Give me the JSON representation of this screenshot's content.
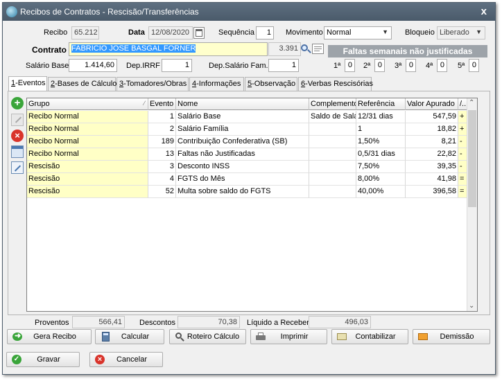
{
  "window": {
    "title": "Recibos de Contratos - Rescisão/Transferências",
    "close": "x"
  },
  "header": {
    "recibo_label": "Recibo",
    "recibo_value": "65.212",
    "data_label": "Data",
    "data_value": "12/08/2020",
    "sequencia_label": "Sequência",
    "sequencia_value": "1",
    "movimento_label": "Movimento",
    "movimento_value": "Normal",
    "bloqueio_label": "Bloqueio",
    "bloqueio_value": "Liberado",
    "contrato_label": "Contrato",
    "contrato_value": "FABRICIO JOSE BASGAL FORNER",
    "contrato_num": "3.391",
    "faltas_banner": "Faltas semanais não justificadas",
    "salario_base_label": "Salário Base",
    "salario_base_value": "1.414,60",
    "dep_irrf_label": "Dep.IRRF",
    "dep_irrf_value": "1",
    "dep_salario_label": "Dep.Salário Fam.",
    "dep_salario_value": "1",
    "weeks": [
      {
        "label": "1ª",
        "value": "0"
      },
      {
        "label": "2ª",
        "value": "0"
      },
      {
        "label": "3ª",
        "value": "0"
      },
      {
        "label": "4ª",
        "value": "0"
      },
      {
        "label": "5ª",
        "value": "0"
      }
    ]
  },
  "tabs": [
    {
      "key": "1",
      "label": "-Eventos",
      "active": true
    },
    {
      "key": "2",
      "label": "-Bases de Cálculo"
    },
    {
      "key": "3",
      "label": "-Tomadores/Obras"
    },
    {
      "key": "4",
      "label": "-Informações"
    },
    {
      "key": "5",
      "label": "-Observação"
    },
    {
      "key": "6",
      "label": "-Verbas Rescisórias"
    }
  ],
  "grid": {
    "columns": [
      "Grupo",
      "Evento",
      "Nome",
      "Complemento",
      "Referência",
      "Valor Apurado",
      "/.."
    ],
    "rows": [
      [
        "Recibo Normal",
        "1",
        "Salário Base",
        "Saldo de Salá",
        "12/31 dias",
        "547,59",
        "+"
      ],
      [
        "Recibo Normal",
        "2",
        "Salário Família",
        "",
        "1",
        "18,82",
        "+"
      ],
      [
        "Recibo Normal",
        "189",
        "Contribuição Confederativa  (SB)",
        "",
        "1,50%",
        "8,21",
        "-"
      ],
      [
        "Recibo Normal",
        "13",
        "Faltas não Justificadas",
        "",
        "0,5/31 dias",
        "22,82",
        "-"
      ],
      [
        "Rescisão",
        "3",
        "Desconto INSS",
        "",
        "7,50%",
        "39,35",
        "-"
      ],
      [
        "Rescisão",
        "4",
        "FGTS do Mês",
        "",
        "8,00%",
        "41,98",
        "="
      ],
      [
        "Rescisão",
        "52",
        "Multa sobre saldo do FGTS",
        "",
        "40,00%",
        "396,58",
        "="
      ]
    ]
  },
  "totals": {
    "proventos_label": "Proventos",
    "proventos_value": "566,41",
    "descontos_label": "Descontos",
    "descontos_value": "70,38",
    "liquido_label": "Líquido a Receber",
    "liquido_value": "496,03"
  },
  "buttons": {
    "gera_recibo": "Gera Recibo",
    "calcular": "Calcular",
    "roteiro": "Roteiro Cálculo",
    "imprimir": "Imprimir",
    "contabilizar": "Contabilizar",
    "demissao": "Demissão",
    "gravar": "Gravar",
    "cancelar": "Cancelar"
  }
}
